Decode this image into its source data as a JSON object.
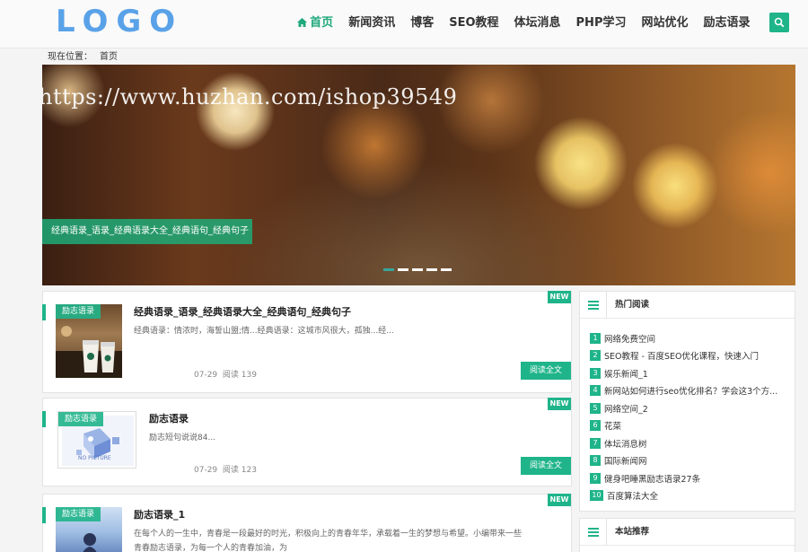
{
  "header": {
    "logo": "LOGO",
    "nav": [
      "首页",
      "新闻资讯",
      "博客",
      "SEO教程",
      "体坛消息",
      "PHP学习",
      "网站优化",
      "励志语录"
    ],
    "active_index": 0,
    "accent_color": "#1fb48a",
    "logo_color": "#5aa2e8"
  },
  "breadcrumb": {
    "label": "现在位置：",
    "current": "首页"
  },
  "banner": {
    "watermark": "https://www.huzhan.com/ishop39549",
    "caption": "经典语录_语录_经典语录大全_经典语句_经典句子",
    "slide_count": 5,
    "active_slide": 0
  },
  "articles": [
    {
      "category": "励志语录",
      "badge": "NEW",
      "title": "经典语录_语录_经典语录大全_经典语句_经典句子",
      "desc": "经典语录：情浓时，海誓山盟;情...经典语录：这城市风很大，孤独...经...",
      "date": "07-29",
      "views": "阅读 139",
      "button": "阅读全文",
      "thumb": "coffee-cups-image"
    },
    {
      "category": "励志语录",
      "badge": "NEW",
      "title": "励志语录",
      "desc": "励志短句说说84...",
      "date": "07-29",
      "views": "阅读 123",
      "button": "阅读全文",
      "thumb": "no-picture-image",
      "thumb_text": "NO PICTURE"
    },
    {
      "category": "励志语录",
      "badge": "NEW",
      "title": "励志语录_1",
      "desc": "在每个人的一生中，青春是一段最好的时光，积极向上的青春年华，承载着一生的梦想与希望。小编带来一些",
      "desc2": "青春励志语录，为每一个人的青春加油，为",
      "thumb": "person-silhouette-image"
    }
  ],
  "sidebar": {
    "hot": {
      "title": "热门阅读",
      "items": [
        {
          "num": "1",
          "text": "网络免费空间"
        },
        {
          "num": "2",
          "text": "SEO教程 - 百度SEO优化课程，快速入门"
        },
        {
          "num": "3",
          "text": "娱乐新闻_1"
        },
        {
          "num": "4",
          "text": "新网站如何进行seo优化排名？学会这3个方..."
        },
        {
          "num": "5",
          "text": "网络空间_2"
        },
        {
          "num": "6",
          "text": "花菜"
        },
        {
          "num": "7",
          "text": "体坛消息树"
        },
        {
          "num": "8",
          "text": "国际新闻网"
        },
        {
          "num": "9",
          "text": "健身吧睡黑励志语录27条"
        },
        {
          "num": "10",
          "text": "百度算法大全"
        }
      ]
    },
    "recommend": {
      "title": "本站推荐"
    }
  }
}
